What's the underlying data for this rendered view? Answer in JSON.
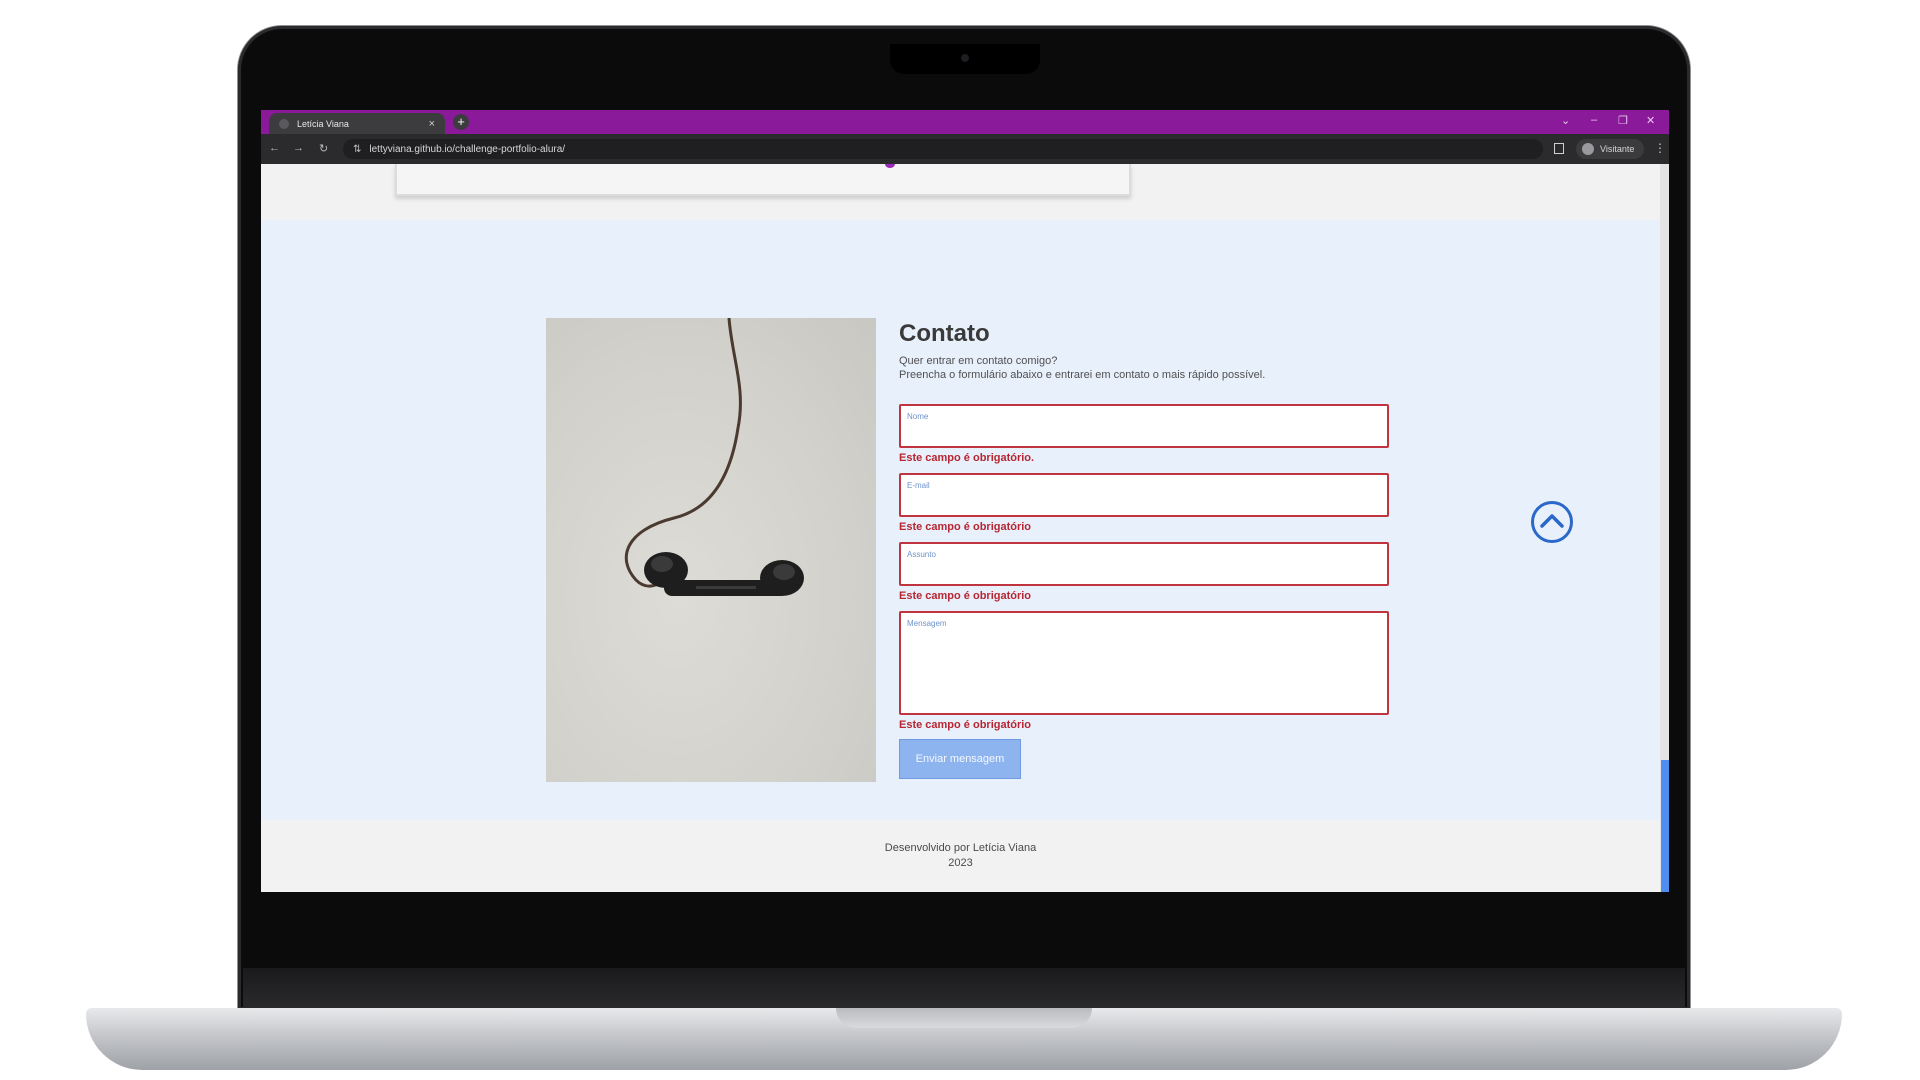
{
  "browser": {
    "tab_title": "Letícia Viana",
    "tab_close": "×",
    "new_tab": "+",
    "url": "lettyviana.github.io/challenge-portfolio-alura/",
    "profile_label": "Visitante",
    "window_controls": [
      "⌄",
      "–",
      "❐",
      "✕"
    ],
    "accent_color": "#8b1a9a"
  },
  "contact": {
    "title": "Contato",
    "description_line1": "Quer entrar em contato comigo?",
    "description_line2": "Preencha o formulário abaixo e entrarei em contato o mais rápido possível.",
    "fields": [
      {
        "label": "Nome",
        "error": "Este campo é obrigatório."
      },
      {
        "label": "E-mail",
        "error": "Este campo é obrigatório"
      },
      {
        "label": "Assunto",
        "error": "Este campo é obrigatório"
      },
      {
        "label": "Mensagem",
        "error": "Este campo é obrigatório"
      }
    ],
    "submit_label": "Enviar mensagem",
    "error_color": "#b72631"
  },
  "footer": {
    "credit": "Desenvolvido por Letícia Viana",
    "year": "2023"
  },
  "icons": {
    "back_to_top": "chevron-up-circle-icon"
  }
}
